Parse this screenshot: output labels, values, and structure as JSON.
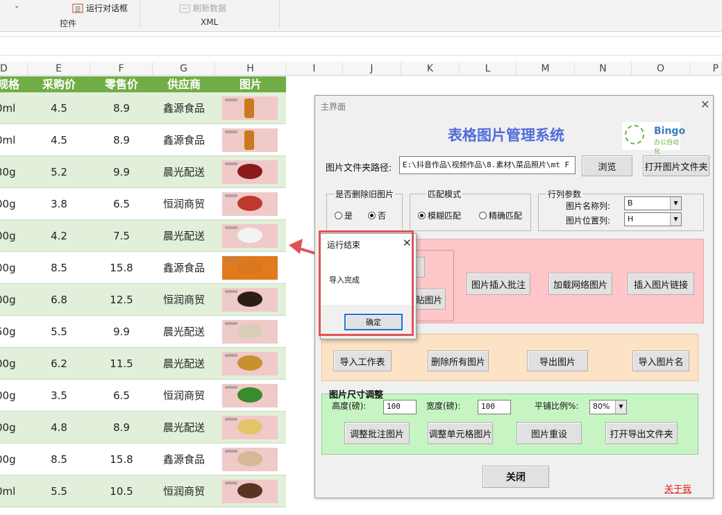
{
  "ribbon": {
    "run_dialog_label": "运行对话框",
    "refresh_label": "刷新数据",
    "group_controls": "控件",
    "group_xml": "XML"
  },
  "columns": [
    "D",
    "E",
    "F",
    "G",
    "H",
    "I",
    "J",
    "K",
    "L",
    "M",
    "N",
    "O",
    "P"
  ],
  "sheet": {
    "headers": [
      "规格",
      "采购价",
      "零售价",
      "供应商",
      "图片"
    ],
    "rows": [
      {
        "spec": "0ml",
        "cost": "4.5",
        "price": "8.9",
        "supplier": "鑫源食品"
      },
      {
        "spec": "0ml",
        "cost": "4.5",
        "price": "8.9",
        "supplier": "鑫源食品"
      },
      {
        "spec": "30g",
        "cost": "5.2",
        "price": "9.9",
        "supplier": "晨光配送"
      },
      {
        "spec": "00g",
        "cost": "3.8",
        "price": "6.5",
        "supplier": "恒润商贸"
      },
      {
        "spec": "00g",
        "cost": "4.2",
        "price": "7.5",
        "supplier": "晨光配送"
      },
      {
        "spec": "00g",
        "cost": "8.5",
        "price": "15.8",
        "supplier": "鑫源食品"
      },
      {
        "spec": "00g",
        "cost": "6.8",
        "price": "12.5",
        "supplier": "恒润商贸"
      },
      {
        "spec": "50g",
        "cost": "5.5",
        "price": "9.9",
        "supplier": "晨光配送"
      },
      {
        "spec": "00g",
        "cost": "6.2",
        "price": "11.5",
        "supplier": "晨光配送"
      },
      {
        "spec": "00g",
        "cost": "3.5",
        "price": "6.5",
        "supplier": "恒润商贸"
      },
      {
        "spec": "00g",
        "cost": "4.8",
        "price": "8.9",
        "supplier": "晨光配送"
      },
      {
        "spec": "00g",
        "cost": "8.5",
        "price": "15.8",
        "supplier": "鑫源食品"
      },
      {
        "spec": "0ml",
        "cost": "5.5",
        "price": "10.5",
        "supplier": "恒润商贸"
      }
    ]
  },
  "main_window": {
    "title": "主界面",
    "heading": "表格图片管理系统",
    "logo_text": "Bingo",
    "logo_sub": "办公自动化",
    "folder_path_label": "图片文件夹路径:",
    "folder_path_value": "E:\\抖音作品\\视频作品\\8.素材\\菜品照片\\mt F",
    "browse_label": "浏览",
    "open_folder_label": "打开图片文件夹",
    "delete_old_title": "是否删除旧图片",
    "yes_label": "是",
    "no_label": "否",
    "match_mode_title": "匹配模式",
    "fuzzy_label": "模糊匹配",
    "exact_label": "精确匹配",
    "rowcol_title": "行列参数",
    "name_col_label": "图片名称列:",
    "name_col_value": "B",
    "pos_col_label": "图片位置列:",
    "pos_col_value": "H",
    "paste_image_label": "贴图片",
    "insert_comment_label": "图片插入批注",
    "load_network_label": "加载网络图片",
    "insert_link_label": "插入图片链接",
    "import_sheet_label": "导入工作表",
    "delete_all_label": "删除所有图片",
    "export_label": "导出图片",
    "import_name_label": "导入图片名",
    "size_title": "图片尺寸调整",
    "height_label": "高度(磅):",
    "height_value": "100",
    "width_label": "宽度(磅):",
    "width_value": "100",
    "ratio_label": "平铺比例%:",
    "ratio_value": "80%",
    "adjust_comment_label": "调整批注图片",
    "adjust_cell_label": "调整单元格图片",
    "reset_label": "图片重设",
    "open_export_label": "打开导出文件夹",
    "close_label": "关闭",
    "about_label": "关于我"
  },
  "dialog": {
    "title": "运行结束",
    "message": "导入完成",
    "ok_label": "确定"
  },
  "colors": {
    "header_green": "#70ad47",
    "row_green": "#e2efda",
    "heading_blue": "#4f6cd8",
    "pink_panel": "#ffc7c9",
    "orange_panel": "#fde3c5",
    "green_panel": "#c6f5c3",
    "annotation_red": "#e05353"
  }
}
